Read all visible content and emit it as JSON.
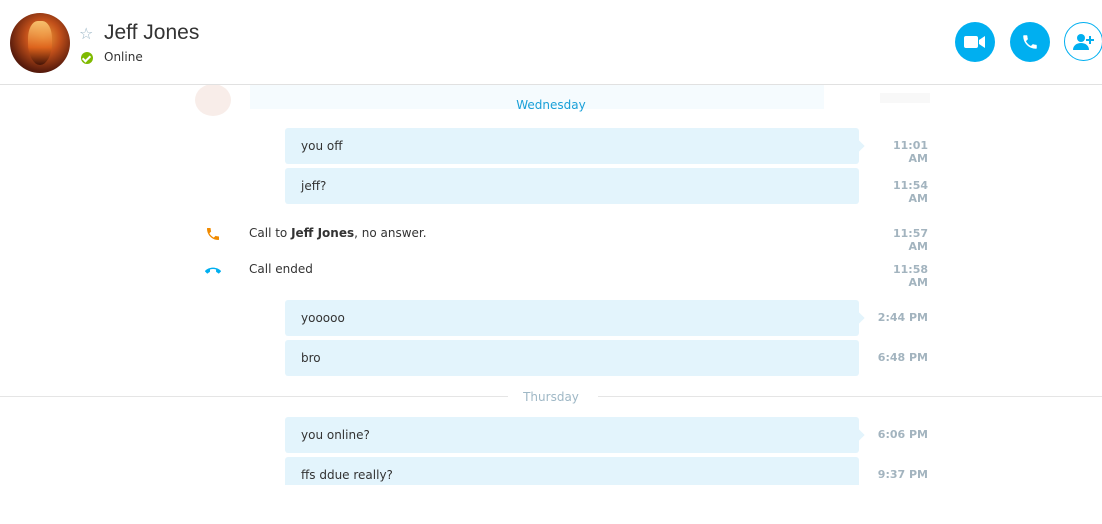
{
  "header": {
    "contact_name": "Jeff Jones",
    "status": "Online",
    "status_color": "#7fba00",
    "favorite_icon": "star-outline-icon",
    "buttons": [
      {
        "name": "video-call-button",
        "icon": "video-camera-icon"
      },
      {
        "name": "audio-call-button",
        "icon": "phone-icon"
      },
      {
        "name": "add-people-button",
        "icon": "add-person-icon"
      }
    ],
    "accent_color": "#00aff0"
  },
  "conversation": {
    "day_separators": [
      "Wednesday",
      "Thursday"
    ],
    "wednesday": {
      "messages": [
        {
          "text": "you off",
          "time": "11:01 AM"
        },
        {
          "text": "jeff?",
          "time": "11:54 AM"
        }
      ],
      "call_events": [
        {
          "prefix": "Call to ",
          "name": "Jeff Jones",
          "suffix": ", no answer.",
          "time": "11:57 AM",
          "icon": "outgoing-call-icon",
          "icon_color": "#f08a00"
        },
        {
          "text": "Call ended",
          "time": "11:58 AM",
          "icon": "hang-up-icon",
          "icon_color": "#00aff0"
        }
      ],
      "later_messages": [
        {
          "text": "yooooo",
          "time": "2:44 PM"
        },
        {
          "text": "bro",
          "time": "6:48 PM"
        }
      ]
    },
    "thursday": {
      "messages": [
        {
          "text": "you online?",
          "time": "6:06 PM"
        },
        {
          "text": "ffs ddue really?",
          "time": "9:37 PM"
        }
      ]
    },
    "bubble_color": "#e3f4fc",
    "time_color": "#a3b4bf"
  }
}
